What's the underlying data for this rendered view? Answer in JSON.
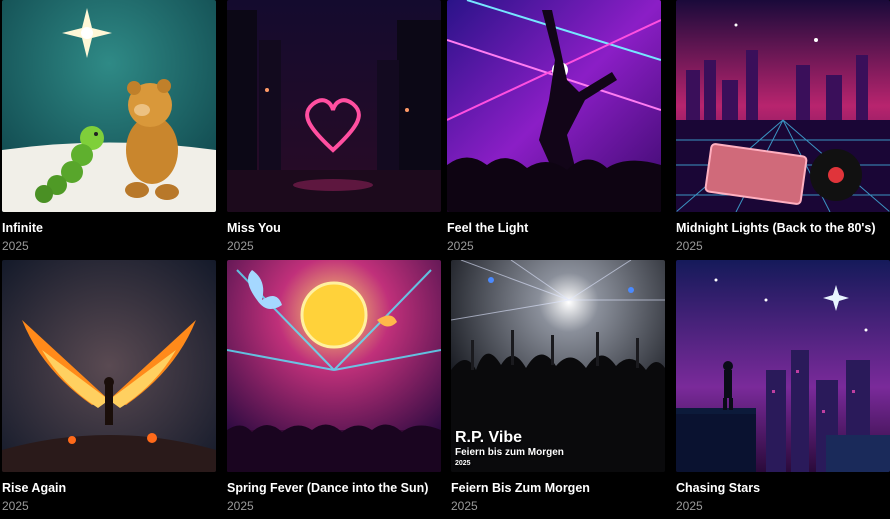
{
  "albums": [
    {
      "title": "Infinite",
      "year": "2025",
      "art": "teddy-bear-caterpillar-star-art"
    },
    {
      "title": "Miss You",
      "year": "2025",
      "art": "neon-heart-city-art"
    },
    {
      "title": "Feel the Light",
      "year": "2025",
      "art": "dancer-concert-lights-art"
    },
    {
      "title": "Midnight Lights (Back to the 80's)",
      "year": "2025",
      "art": "retro-cassette-skyline-art"
    },
    {
      "title": "Rise Again",
      "year": "2025",
      "art": "phoenix-wings-storm-art"
    },
    {
      "title": "Spring Fever (Dance into the Sun)",
      "year": "2025",
      "art": "butterfly-sun-festival-art"
    },
    {
      "title": "Feiern Bis Zum Morgen",
      "year": "2025",
      "art": "crowd-party-lights-art",
      "overlay": {
        "artist": "R.P. Vibe",
        "subtitle": "Feiern bis zum Morgen",
        "year": "2025"
      }
    },
    {
      "title": "Chasing Stars",
      "year": "2025",
      "art": "rooftop-starry-city-art"
    }
  ]
}
